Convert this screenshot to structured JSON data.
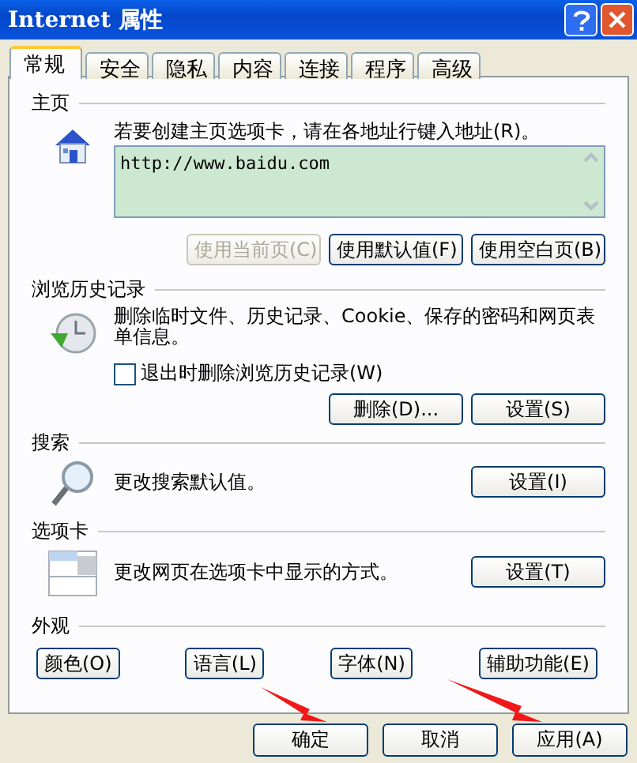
{
  "window": {
    "title": "Internet 属性"
  },
  "tabs": [
    {
      "label": "常规",
      "selected": true
    },
    {
      "label": "安全",
      "selected": false
    },
    {
      "label": "隐私",
      "selected": false
    },
    {
      "label": "内容",
      "selected": false
    },
    {
      "label": "连接",
      "selected": false
    },
    {
      "label": "程序",
      "selected": false
    },
    {
      "label": "高级",
      "selected": false
    }
  ],
  "homepage": {
    "title": "主页",
    "description": "若要创建主页选项卡，请在各地址行键入地址(R)。",
    "url": "http://www.baidu.com",
    "buttons": [
      {
        "label": "使用当前页(C)",
        "disabled": true
      },
      {
        "label": "使用默认值(F)",
        "disabled": false
      },
      {
        "label": "使用空白页(B)",
        "disabled": false
      }
    ]
  },
  "history": {
    "title": "浏览历史记录",
    "description": "删除临时文件、历史记录、Cookie、保存的密码和网页表单信息。",
    "checkbox": {
      "label": "退出时删除浏览历史记录(W)",
      "checked": false
    },
    "buttons": [
      {
        "label": "删除(D)..."
      },
      {
        "label": "设置(S)"
      }
    ]
  },
  "search": {
    "title": "搜索",
    "description": "更改搜索默认值。",
    "button": "设置(I)"
  },
  "tab_settings": {
    "title": "选项卡",
    "description": "更改网页在选项卡中显示的方式。",
    "button": "设置(T)"
  },
  "appearance": {
    "title": "外观",
    "buttons": [
      {
        "label": "颜色(O)"
      },
      {
        "label": "语言(L)"
      },
      {
        "label": "字体(N)"
      },
      {
        "label": "辅助功能(E)"
      }
    ]
  },
  "footer_buttons": [
    {
      "label": "确定"
    },
    {
      "label": "取消"
    },
    {
      "label": "应用(A)"
    }
  ]
}
